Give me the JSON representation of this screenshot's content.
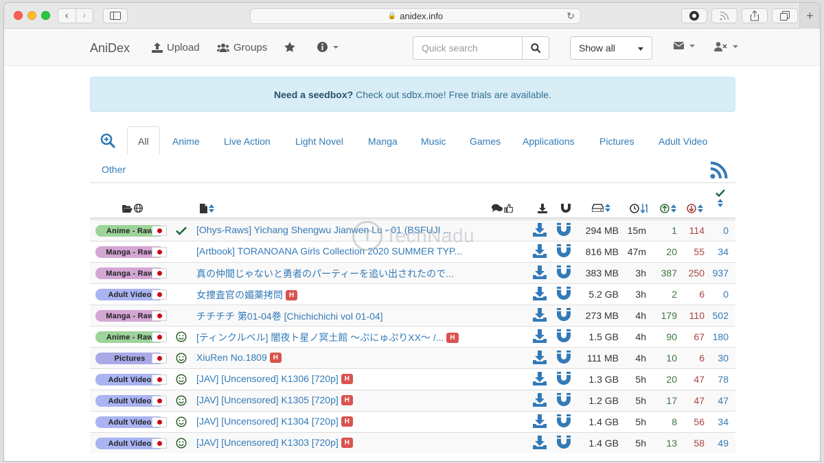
{
  "browser": {
    "url": "anidex.info",
    "back_glyph": "‹",
    "forward_glyph": "›",
    "add_tab_glyph": "+"
  },
  "navbar": {
    "brand": "AniDex",
    "upload": "Upload",
    "groups": "Groups",
    "search_placeholder": "Quick search",
    "filter_value": "Show all"
  },
  "alert": {
    "bold": "Need a seedbox?",
    "text": "Check out sdbx.moe! Free trials are available."
  },
  "tabs": [
    "All",
    "Anime",
    "Live Action",
    "Light Novel",
    "Manga",
    "Music",
    "Games",
    "Applications",
    "Pictures",
    "Adult Video",
    "Other"
  ],
  "categories": {
    "anime_raw": {
      "label": "Anime - Raw",
      "color": "#9ed49a"
    },
    "manga_raw": {
      "label": "Manga - Raw",
      "color": "#d4a6d4"
    },
    "adult_video": {
      "label": "Adult Video",
      "color": "#aab4f2"
    },
    "pictures": {
      "label": "Pictures",
      "color": "#a9a9e8"
    }
  },
  "colors": {
    "link": "#337ab7",
    "seeders": "#3c763d",
    "leechers": "#a94442",
    "hentai_badge": "#d9534f"
  },
  "watermark": "TechNadu",
  "torrents": [
    {
      "cat": "anime_raw",
      "status": "check",
      "title": "[Ohys-Raws] Yichang Shengwu Jianwen Lu - 01 (BSFUJI ...",
      "h": false,
      "size": "294 MB",
      "age": "15m",
      "seeders": "1",
      "leechers": "114",
      "completed": "0"
    },
    {
      "cat": "manga_raw",
      "status": "",
      "title": "[Artbook] TORANOANA Girls Collection 2020 SUMMER TYP...",
      "h": false,
      "size": "816 MB",
      "age": "47m",
      "seeders": "20",
      "leechers": "55",
      "completed": "34"
    },
    {
      "cat": "manga_raw",
      "status": "",
      "title": "真の仲間じゃないと勇者のパーティーを追い出されたので...",
      "h": false,
      "size": "383 MB",
      "age": "3h",
      "seeders": "387",
      "leechers": "250",
      "completed": "937"
    },
    {
      "cat": "adult_video",
      "status": "",
      "title": "女捜査官の媚薬拷問",
      "h": true,
      "size": "5.2 GB",
      "age": "3h",
      "seeders": "2",
      "leechers": "6",
      "completed": "0"
    },
    {
      "cat": "manga_raw",
      "status": "",
      "title": "チチチチ 第01-04巻 [Chichichichi vol 01-04]",
      "h": false,
      "size": "273 MB",
      "age": "4h",
      "seeders": "179",
      "leechers": "110",
      "completed": "502"
    },
    {
      "cat": "anime_raw",
      "status": "smile",
      "title": "[ティンクルベル] 闇夜ト星ノ冥土館 ～ぷにゅぷりXX～ /...",
      "h": true,
      "size": "1.5 GB",
      "age": "4h",
      "seeders": "90",
      "leechers": "67",
      "completed": "180"
    },
    {
      "cat": "pictures",
      "status": "smile",
      "title": "XiuRen No.1809",
      "h": true,
      "size": "111 MB",
      "age": "4h",
      "seeders": "10",
      "leechers": "6",
      "completed": "30"
    },
    {
      "cat": "adult_video",
      "status": "smile",
      "title": "[JAV] [Uncensored] K1306 [720p]",
      "h": true,
      "size": "1.3 GB",
      "age": "5h",
      "seeders": "20",
      "leechers": "47",
      "completed": "78"
    },
    {
      "cat": "adult_video",
      "status": "smile",
      "title": "[JAV] [Uncensored] K1305 [720p]",
      "h": true,
      "size": "1.2 GB",
      "age": "5h",
      "seeders": "17",
      "leechers": "47",
      "completed": "47"
    },
    {
      "cat": "adult_video",
      "status": "smile",
      "title": "[JAV] [Uncensored] K1304 [720p]",
      "h": true,
      "size": "1.4 GB",
      "age": "5h",
      "seeders": "8",
      "leechers": "56",
      "completed": "34"
    },
    {
      "cat": "adult_video",
      "status": "smile",
      "title": "[JAV] [Uncensored] K1303 [720p]",
      "h": true,
      "size": "1.4 GB",
      "age": "5h",
      "seeders": "13",
      "leechers": "58",
      "completed": "49"
    }
  ]
}
